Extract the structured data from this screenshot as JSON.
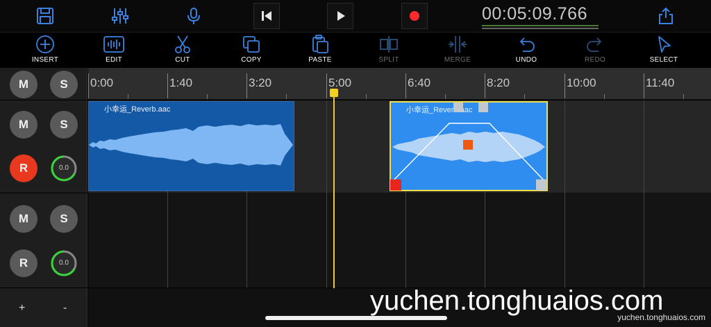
{
  "topbar": {
    "icons": [
      "save-icon",
      "mixer-icon",
      "microphone-icon",
      "skip-back-icon",
      "play-icon",
      "record-icon",
      "share-icon"
    ],
    "timecode": "00:05:09.766"
  },
  "toolbar": {
    "insert": "INSERT",
    "edit": "EDIT",
    "cut": "CUT",
    "copy": "COPY",
    "paste": "PASTE",
    "split": "SPLIT",
    "merge": "MERGE",
    "undo": "UNDO",
    "redo": "REDO",
    "select": "SELECT"
  },
  "header_row": {
    "mute": "M",
    "solo": "S"
  },
  "track1": {
    "mute": "M",
    "solo": "S",
    "record": "R",
    "volume": "0.0"
  },
  "track2": {
    "mute": "M",
    "solo": "S",
    "record": "R",
    "volume": "0.0"
  },
  "bottom": {
    "add": "+",
    "remove": "-"
  },
  "ruler": {
    "ticks": [
      "0:00",
      "1:40",
      "3:20",
      "5:00",
      "6:40",
      "8:20",
      "10:00",
      "11:40"
    ]
  },
  "clips": [
    {
      "name": "小幸运_Reverb.aac",
      "selected": false
    },
    {
      "name": "小幸运_Reverb.aac",
      "selected": true
    }
  ],
  "watermark": {
    "big": "yuchen.tonghuaios.com",
    "small": "yuchen.tonghuaios.com"
  },
  "colors": {
    "accent": "#2f8df0",
    "record": "#e8391f",
    "playhead": "#e9cf2a",
    "clip_dark": "#1459a6",
    "selection": "#f1e04a"
  }
}
